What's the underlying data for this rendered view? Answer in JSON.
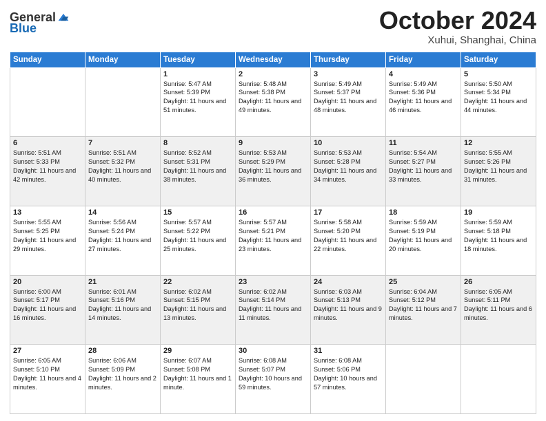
{
  "header": {
    "logo_general": "General",
    "logo_blue": "Blue",
    "month_title": "October 2024",
    "location": "Xuhui, Shanghai, China"
  },
  "days_of_week": [
    "Sunday",
    "Monday",
    "Tuesday",
    "Wednesday",
    "Thursday",
    "Friday",
    "Saturday"
  ],
  "weeks": [
    [
      {
        "day": "",
        "info": ""
      },
      {
        "day": "",
        "info": ""
      },
      {
        "day": "1",
        "info": "Sunrise: 5:47 AM\nSunset: 5:39 PM\nDaylight: 11 hours and 51 minutes."
      },
      {
        "day": "2",
        "info": "Sunrise: 5:48 AM\nSunset: 5:38 PM\nDaylight: 11 hours and 49 minutes."
      },
      {
        "day": "3",
        "info": "Sunrise: 5:49 AM\nSunset: 5:37 PM\nDaylight: 11 hours and 48 minutes."
      },
      {
        "day": "4",
        "info": "Sunrise: 5:49 AM\nSunset: 5:36 PM\nDaylight: 11 hours and 46 minutes."
      },
      {
        "day": "5",
        "info": "Sunrise: 5:50 AM\nSunset: 5:34 PM\nDaylight: 11 hours and 44 minutes."
      }
    ],
    [
      {
        "day": "6",
        "info": "Sunrise: 5:51 AM\nSunset: 5:33 PM\nDaylight: 11 hours and 42 minutes."
      },
      {
        "day": "7",
        "info": "Sunrise: 5:51 AM\nSunset: 5:32 PM\nDaylight: 11 hours and 40 minutes."
      },
      {
        "day": "8",
        "info": "Sunrise: 5:52 AM\nSunset: 5:31 PM\nDaylight: 11 hours and 38 minutes."
      },
      {
        "day": "9",
        "info": "Sunrise: 5:53 AM\nSunset: 5:29 PM\nDaylight: 11 hours and 36 minutes."
      },
      {
        "day": "10",
        "info": "Sunrise: 5:53 AM\nSunset: 5:28 PM\nDaylight: 11 hours and 34 minutes."
      },
      {
        "day": "11",
        "info": "Sunrise: 5:54 AM\nSunset: 5:27 PM\nDaylight: 11 hours and 33 minutes."
      },
      {
        "day": "12",
        "info": "Sunrise: 5:55 AM\nSunset: 5:26 PM\nDaylight: 11 hours and 31 minutes."
      }
    ],
    [
      {
        "day": "13",
        "info": "Sunrise: 5:55 AM\nSunset: 5:25 PM\nDaylight: 11 hours and 29 minutes."
      },
      {
        "day": "14",
        "info": "Sunrise: 5:56 AM\nSunset: 5:24 PM\nDaylight: 11 hours and 27 minutes."
      },
      {
        "day": "15",
        "info": "Sunrise: 5:57 AM\nSunset: 5:22 PM\nDaylight: 11 hours and 25 minutes."
      },
      {
        "day": "16",
        "info": "Sunrise: 5:57 AM\nSunset: 5:21 PM\nDaylight: 11 hours and 23 minutes."
      },
      {
        "day": "17",
        "info": "Sunrise: 5:58 AM\nSunset: 5:20 PM\nDaylight: 11 hours and 22 minutes."
      },
      {
        "day": "18",
        "info": "Sunrise: 5:59 AM\nSunset: 5:19 PM\nDaylight: 11 hours and 20 minutes."
      },
      {
        "day": "19",
        "info": "Sunrise: 5:59 AM\nSunset: 5:18 PM\nDaylight: 11 hours and 18 minutes."
      }
    ],
    [
      {
        "day": "20",
        "info": "Sunrise: 6:00 AM\nSunset: 5:17 PM\nDaylight: 11 hours and 16 minutes."
      },
      {
        "day": "21",
        "info": "Sunrise: 6:01 AM\nSunset: 5:16 PM\nDaylight: 11 hours and 14 minutes."
      },
      {
        "day": "22",
        "info": "Sunrise: 6:02 AM\nSunset: 5:15 PM\nDaylight: 11 hours and 13 minutes."
      },
      {
        "day": "23",
        "info": "Sunrise: 6:02 AM\nSunset: 5:14 PM\nDaylight: 11 hours and 11 minutes."
      },
      {
        "day": "24",
        "info": "Sunrise: 6:03 AM\nSunset: 5:13 PM\nDaylight: 11 hours and 9 minutes."
      },
      {
        "day": "25",
        "info": "Sunrise: 6:04 AM\nSunset: 5:12 PM\nDaylight: 11 hours and 7 minutes."
      },
      {
        "day": "26",
        "info": "Sunrise: 6:05 AM\nSunset: 5:11 PM\nDaylight: 11 hours and 6 minutes."
      }
    ],
    [
      {
        "day": "27",
        "info": "Sunrise: 6:05 AM\nSunset: 5:10 PM\nDaylight: 11 hours and 4 minutes."
      },
      {
        "day": "28",
        "info": "Sunrise: 6:06 AM\nSunset: 5:09 PM\nDaylight: 11 hours and 2 minutes."
      },
      {
        "day": "29",
        "info": "Sunrise: 6:07 AM\nSunset: 5:08 PM\nDaylight: 11 hours and 1 minute."
      },
      {
        "day": "30",
        "info": "Sunrise: 6:08 AM\nSunset: 5:07 PM\nDaylight: 10 hours and 59 minutes."
      },
      {
        "day": "31",
        "info": "Sunrise: 6:08 AM\nSunset: 5:06 PM\nDaylight: 10 hours and 57 minutes."
      },
      {
        "day": "",
        "info": ""
      },
      {
        "day": "",
        "info": ""
      }
    ]
  ]
}
